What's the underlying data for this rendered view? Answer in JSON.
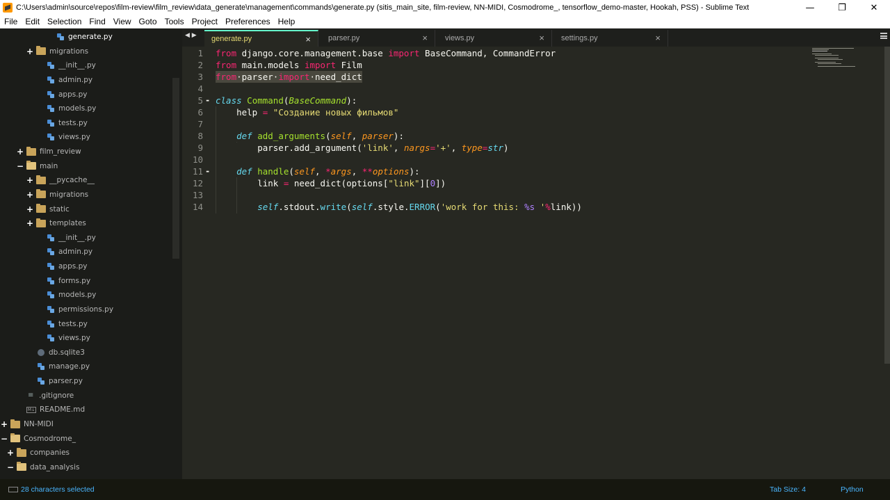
{
  "window": {
    "title": "C:\\Users\\admin\\source\\repos\\film-review\\film_review\\data_generate\\management\\commands\\generate.py (sitis_main_site, film-review, NN-MIDI, Cosmodrome_, tensorflow_demo-master, Hookah, PSS) - Sublime Text",
    "minimize": "—",
    "maximize": "❐",
    "close": "✕"
  },
  "menu": [
    "File",
    "Edit",
    "Selection",
    "Find",
    "View",
    "Goto",
    "Tools",
    "Project",
    "Preferences",
    "Help"
  ],
  "sidebar": {
    "items": [
      {
        "label": "generate.py",
        "icon": "python-file-icon",
        "expander": ""
      },
      {
        "label": "migrations",
        "icon": "folder-icon",
        "expander": "+"
      },
      {
        "label": "__init__.py",
        "icon": "python-file-icon",
        "expander": ""
      },
      {
        "label": "admin.py",
        "icon": "python-file-icon",
        "expander": ""
      },
      {
        "label": "apps.py",
        "icon": "python-file-icon",
        "expander": ""
      },
      {
        "label": "models.py",
        "icon": "python-file-icon",
        "expander": ""
      },
      {
        "label": "tests.py",
        "icon": "python-file-icon",
        "expander": ""
      },
      {
        "label": "views.py",
        "icon": "python-file-icon",
        "expander": ""
      },
      {
        "label": "film_review",
        "icon": "folder-icon",
        "expander": "+"
      },
      {
        "label": "main",
        "icon": "folder-open-icon",
        "expander": "−"
      },
      {
        "label": "__pycache__",
        "icon": "folder-icon",
        "expander": "+"
      },
      {
        "label": "migrations",
        "icon": "folder-icon",
        "expander": "+"
      },
      {
        "label": "static",
        "icon": "folder-icon",
        "expander": "+"
      },
      {
        "label": "templates",
        "icon": "folder-icon",
        "expander": "+"
      },
      {
        "label": "__init__.py",
        "icon": "python-file-icon",
        "expander": ""
      },
      {
        "label": "admin.py",
        "icon": "python-file-icon",
        "expander": ""
      },
      {
        "label": "apps.py",
        "icon": "python-file-icon",
        "expander": ""
      },
      {
        "label": "forms.py",
        "icon": "python-file-icon",
        "expander": ""
      },
      {
        "label": "models.py",
        "icon": "python-file-icon",
        "expander": ""
      },
      {
        "label": "permissions.py",
        "icon": "python-file-icon",
        "expander": ""
      },
      {
        "label": "tests.py",
        "icon": "python-file-icon",
        "expander": ""
      },
      {
        "label": "views.py",
        "icon": "python-file-icon",
        "expander": ""
      },
      {
        "label": "db.sqlite3",
        "icon": "database-file-icon",
        "expander": ""
      },
      {
        "label": "manage.py",
        "icon": "python-file-icon",
        "expander": ""
      },
      {
        "label": "parser.py",
        "icon": "python-file-icon",
        "expander": ""
      },
      {
        "label": ".gitignore",
        "icon": "text-file-icon",
        "expander": ""
      },
      {
        "label": "README.md",
        "icon": "markdown-file-icon",
        "expander": ""
      },
      {
        "label": "NN-MIDI",
        "icon": "folder-icon",
        "expander": "+"
      },
      {
        "label": "Cosmodrome_",
        "icon": "folder-open-icon",
        "expander": "−"
      },
      {
        "label": "companies",
        "icon": "folder-icon",
        "expander": "+"
      },
      {
        "label": "data_analysis",
        "icon": "folder-open-icon",
        "expander": "−"
      }
    ]
  },
  "tabs": [
    {
      "label": "generate.py",
      "active": true,
      "close": "×"
    },
    {
      "label": "parser.py",
      "active": false,
      "close": "×"
    },
    {
      "label": "views.py",
      "active": false,
      "close": "×"
    },
    {
      "label": "settings.py",
      "active": false,
      "close": "×"
    }
  ],
  "tab_nav": "◀ ▶",
  "editor": {
    "line_numbers": [
      "1",
      "2",
      "3",
      "4",
      "5",
      "6",
      "7",
      "8",
      "9",
      "10",
      "11",
      "12",
      "13",
      "14"
    ],
    "fold_marks": {
      "line5": "-",
      "line11": "-"
    }
  },
  "status": {
    "selection": "28 characters selected",
    "tab_size": "Tab Size: 4",
    "syntax": "Python"
  },
  "colors": {
    "editor_bg": "#272822",
    "sidebar_bg": "#1b1c19",
    "keyword": "#f92672",
    "string": "#e6db74",
    "function": "#a6e22e",
    "builtin": "#66d9ef",
    "parameter": "#fd971f",
    "number": "#ae81ff"
  }
}
